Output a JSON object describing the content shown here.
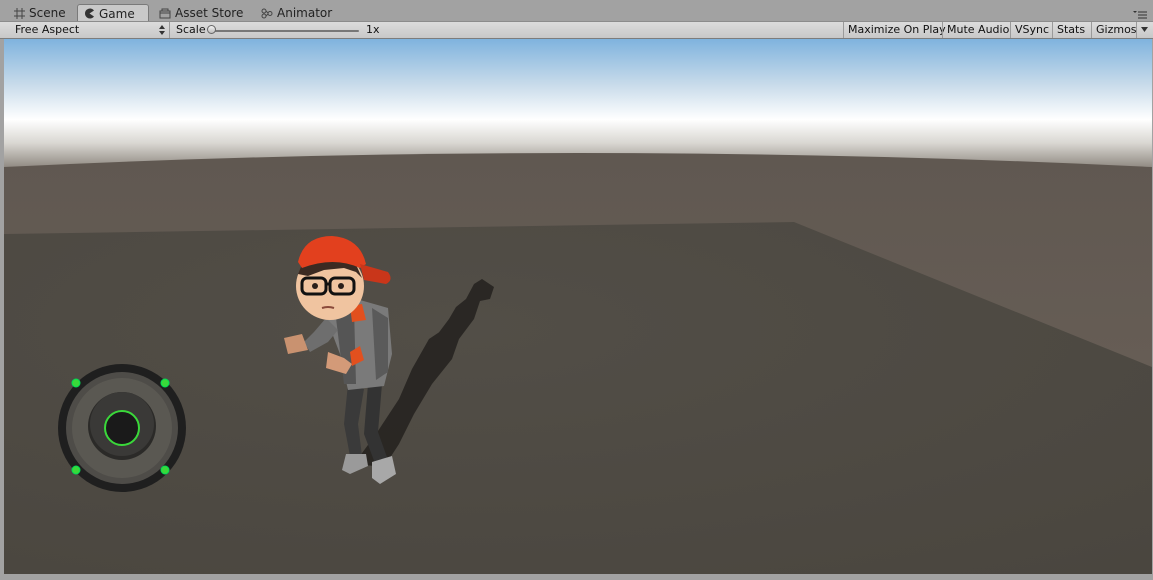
{
  "tabs": [
    {
      "label": "Scene",
      "icon": "grid-icon"
    },
    {
      "label": "Game",
      "icon": "pacman-icon"
    },
    {
      "label": "Asset Store",
      "icon": "store-icon"
    },
    {
      "label": "Animator",
      "icon": "animator-icon"
    }
  ],
  "active_tab": "Game",
  "toolbar": {
    "aspect": "Free Aspect",
    "scale_label": "Scale",
    "scale_value": "1x",
    "maximize": "Maximize On Play",
    "mute": "Mute Audio",
    "vsync": "VSync",
    "stats": "Stats",
    "gizmos": "Gizmos"
  },
  "colors": {
    "sky_top": "#7fb3de",
    "horizon": "#ffffff",
    "ground": "#4f4b44",
    "joystick_ring": "#2a2a2a",
    "joystick_accent": "#3ad83a",
    "cap": "#e2401e"
  }
}
